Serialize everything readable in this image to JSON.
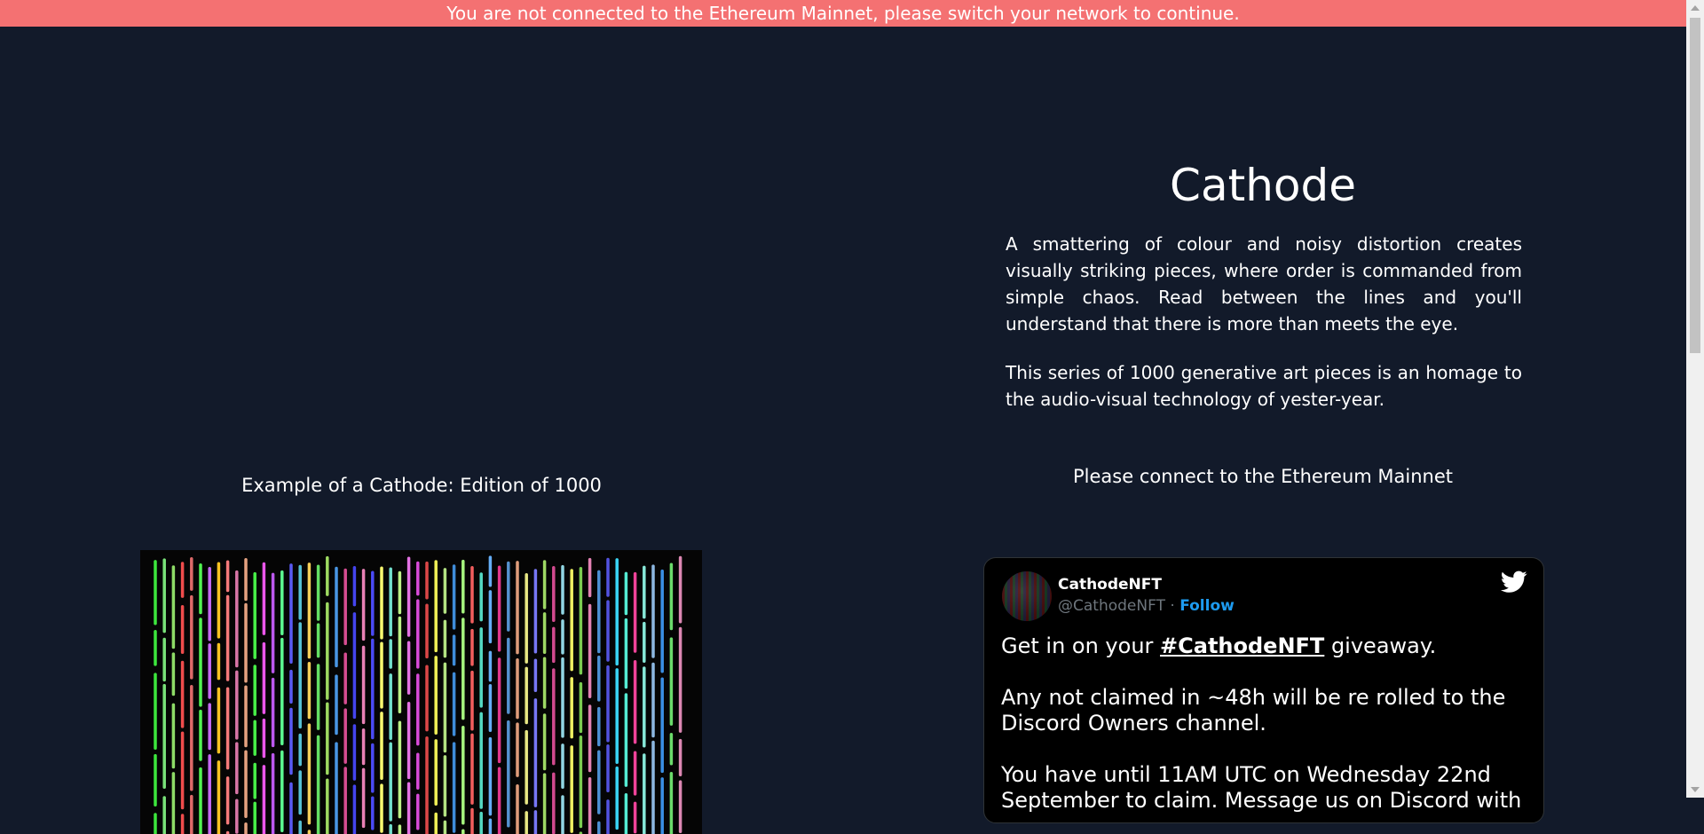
{
  "banner": {
    "text": "You are not connected to the Ethereum Mainnet, please switch your network to continue.",
    "color": "#f47172"
  },
  "colors": {
    "background": "#121a2a",
    "text": "#ffffff",
    "tweet_link": "#1d9bf0"
  },
  "project": {
    "title": "Cathode",
    "description_1": "A smattering of colour and noisy distortion creates visually striking pieces, where order is commanded from simple chaos. Read between the lines and you'll understand that there is more than meets the eye.",
    "description_2": "This series of 1000 generative art pieces is an homage to the audio-visual technology of yester-year.",
    "connect_note": "Please connect to the Ethereum Mainnet"
  },
  "example": {
    "caption": "Example of a Cathode: Edition of 1000"
  },
  "tweet": {
    "name": "CathodeNFT",
    "handle": "@CathodeNFT",
    "separator": "·",
    "follow_label": "Follow",
    "text_before": "Get in on your ",
    "hashtag": "#CathodeNFT",
    "text_after": " giveaway.\n\nAny not claimed in ~48h will be re rolled to the Discord Owners channel.\n\nYou have until 11AM UTC on Wednesday 22nd September to claim. Message us on Discord with",
    "icon": "twitter-bird-icon"
  }
}
